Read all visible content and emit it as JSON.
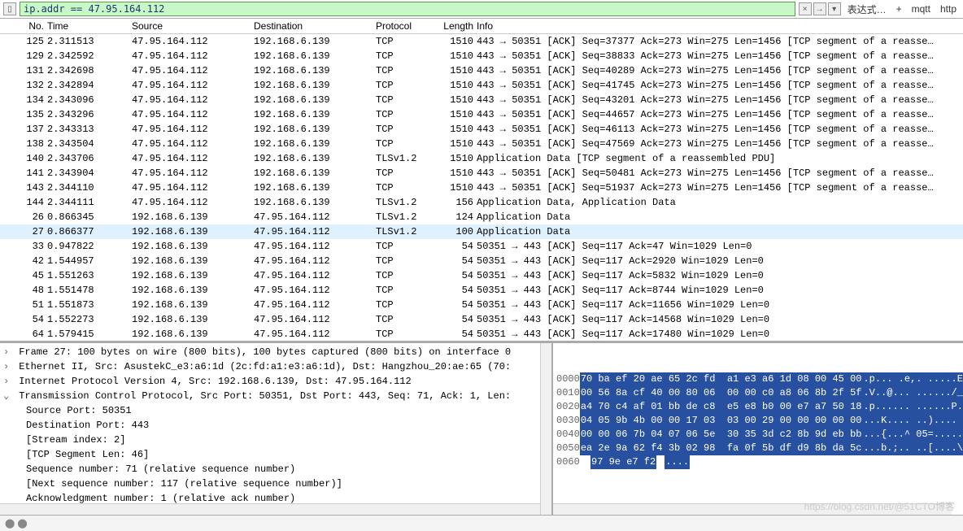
{
  "filter": {
    "value": "ip.addr == 47.95.164.112",
    "clear_icon": "×",
    "dropdown_icon": "▾",
    "expression_label": "表达式…",
    "plus": "+",
    "link_mqtt": "mqtt",
    "link_http": "http"
  },
  "columns": {
    "no": "No.",
    "time": "Time",
    "source": "Source",
    "destination": "Destination",
    "protocol": "Protocol",
    "length": "Length",
    "info": "Info"
  },
  "packets": [
    {
      "no": "125",
      "time": "2.311513",
      "src": "47.95.164.112",
      "dst": "192.168.6.139",
      "proto": "TCP",
      "len": "1510",
      "info": "443 → 50351 [ACK] Seq=37377 Ack=273 Win=275 Len=1456 [TCP segment of a reasse…"
    },
    {
      "no": "129",
      "time": "2.342592",
      "src": "47.95.164.112",
      "dst": "192.168.6.139",
      "proto": "TCP",
      "len": "1510",
      "info": "443 → 50351 [ACK] Seq=38833 Ack=273 Win=275 Len=1456 [TCP segment of a reasse…"
    },
    {
      "no": "131",
      "time": "2.342698",
      "src": "47.95.164.112",
      "dst": "192.168.6.139",
      "proto": "TCP",
      "len": "1510",
      "info": "443 → 50351 [ACK] Seq=40289 Ack=273 Win=275 Len=1456 [TCP segment of a reasse…"
    },
    {
      "no": "132",
      "time": "2.342894",
      "src": "47.95.164.112",
      "dst": "192.168.6.139",
      "proto": "TCP",
      "len": "1510",
      "info": "443 → 50351 [ACK] Seq=41745 Ack=273 Win=275 Len=1456 [TCP segment of a reasse…"
    },
    {
      "no": "134",
      "time": "2.343096",
      "src": "47.95.164.112",
      "dst": "192.168.6.139",
      "proto": "TCP",
      "len": "1510",
      "info": "443 → 50351 [ACK] Seq=43201 Ack=273 Win=275 Len=1456 [TCP segment of a reasse…"
    },
    {
      "no": "135",
      "time": "2.343296",
      "src": "47.95.164.112",
      "dst": "192.168.6.139",
      "proto": "TCP",
      "len": "1510",
      "info": "443 → 50351 [ACK] Seq=44657 Ack=273 Win=275 Len=1456 [TCP segment of a reasse…"
    },
    {
      "no": "137",
      "time": "2.343313",
      "src": "47.95.164.112",
      "dst": "192.168.6.139",
      "proto": "TCP",
      "len": "1510",
      "info": "443 → 50351 [ACK] Seq=46113 Ack=273 Win=275 Len=1456 [TCP segment of a reasse…"
    },
    {
      "no": "138",
      "time": "2.343504",
      "src": "47.95.164.112",
      "dst": "192.168.6.139",
      "proto": "TCP",
      "len": "1510",
      "info": "443 → 50351 [ACK] Seq=47569 Ack=273 Win=275 Len=1456 [TCP segment of a reasse…"
    },
    {
      "no": "140",
      "time": "2.343706",
      "src": "47.95.164.112",
      "dst": "192.168.6.139",
      "proto": "TLSv1.2",
      "len": "1510",
      "info": "Application Data [TCP segment of a reassembled PDU]"
    },
    {
      "no": "141",
      "time": "2.343904",
      "src": "47.95.164.112",
      "dst": "192.168.6.139",
      "proto": "TCP",
      "len": "1510",
      "info": "443 → 50351 [ACK] Seq=50481 Ack=273 Win=275 Len=1456 [TCP segment of a reasse…"
    },
    {
      "no": "143",
      "time": "2.344110",
      "src": "47.95.164.112",
      "dst": "192.168.6.139",
      "proto": "TCP",
      "len": "1510",
      "info": "443 → 50351 [ACK] Seq=51937 Ack=273 Win=275 Len=1456 [TCP segment of a reasse…"
    },
    {
      "no": "144",
      "time": "2.344111",
      "src": "47.95.164.112",
      "dst": "192.168.6.139",
      "proto": "TLSv1.2",
      "len": "156",
      "info": "Application Data, Application Data"
    },
    {
      "no": "26",
      "time": "0.866345",
      "src": "192.168.6.139",
      "dst": "47.95.164.112",
      "proto": "TLSv1.2",
      "len": "124",
      "info": "Application Data"
    },
    {
      "no": "27",
      "time": "0.866377",
      "src": "192.168.6.139",
      "dst": "47.95.164.112",
      "proto": "TLSv1.2",
      "len": "100",
      "info": "Application Data"
    },
    {
      "no": "33",
      "time": "0.947822",
      "src": "192.168.6.139",
      "dst": "47.95.164.112",
      "proto": "TCP",
      "len": "54",
      "info": "50351 → 443 [ACK] Seq=117 Ack=47 Win=1029 Len=0"
    },
    {
      "no": "42",
      "time": "1.544957",
      "src": "192.168.6.139",
      "dst": "47.95.164.112",
      "proto": "TCP",
      "len": "54",
      "info": "50351 → 443 [ACK] Seq=117 Ack=2920 Win=1029 Len=0"
    },
    {
      "no": "45",
      "time": "1.551263",
      "src": "192.168.6.139",
      "dst": "47.95.164.112",
      "proto": "TCP",
      "len": "54",
      "info": "50351 → 443 [ACK] Seq=117 Ack=5832 Win=1029 Len=0"
    },
    {
      "no": "48",
      "time": "1.551478",
      "src": "192.168.6.139",
      "dst": "47.95.164.112",
      "proto": "TCP",
      "len": "54",
      "info": "50351 → 443 [ACK] Seq=117 Ack=8744 Win=1029 Len=0"
    },
    {
      "no": "51",
      "time": "1.551873",
      "src": "192.168.6.139",
      "dst": "47.95.164.112",
      "proto": "TCP",
      "len": "54",
      "info": "50351 → 443 [ACK] Seq=117 Ack=11656 Win=1029 Len=0"
    },
    {
      "no": "54",
      "time": "1.552273",
      "src": "192.168.6.139",
      "dst": "47.95.164.112",
      "proto": "TCP",
      "len": "54",
      "info": "50351 → 443 [ACK] Seq=117 Ack=14568 Win=1029 Len=0"
    },
    {
      "no": "64",
      "time": "1.579415",
      "src": "192.168.6.139",
      "dst": "47.95.164.112",
      "proto": "TCP",
      "len": "54",
      "info": "50351 → 443 [ACK] Seq=117 Ack=17480 Win=1029 Len=0"
    }
  ],
  "selected_index": 13,
  "details": {
    "frame": "Frame 27: 100 bytes on wire (800 bits), 100 bytes captured (800 bits) on interface 0",
    "eth": "Ethernet II, Src: AsustekC_e3:a6:1d (2c:fd:a1:e3:a6:1d), Dst: Hangzhou_20:ae:65 (70:",
    "ip": "Internet Protocol Version 4, Src: 192.168.6.139, Dst: 47.95.164.112",
    "tcp": "Transmission Control Protocol, Src Port: 50351, Dst Port: 443, Seq: 71, Ack: 1, Len:",
    "tcp_children": [
      "Source Port: 50351",
      "Destination Port: 443",
      "[Stream index: 2]",
      "[TCP Segment Len: 46]",
      "Sequence number: 71    (relative sequence number)",
      "[Next sequence number: 117    (relative sequence number)]",
      "Acknowledgment number: 1    (relative ack number)"
    ]
  },
  "hex": {
    "rows": [
      {
        "off": "0000",
        "b1": "70 ba ef 20 ae 65 2c fd",
        "b2": "a1 e3 a6 1d 08 00 45 00",
        "a": ".p... .e,. .....E."
      },
      {
        "off": "0010",
        "b1": "00 56 8a cf 40 00 80 06",
        "b2": "00 00 c0 a8 06 8b 2f 5f",
        "a": ".V..@... ....../_"
      },
      {
        "off": "0020",
        "b1": "a4 70 c4 af 01 bb de c8",
        "b2": "e5 e8 b0 00 e7 a7 50 18",
        "a": ".p...... ......P."
      },
      {
        "off": "0030",
        "b1": "04 05 9b 4b 00 00 17 03",
        "b2": "03 00 29 00 00 00 00 00",
        "a": "...K.... ..).... "
      },
      {
        "off": "0040",
        "b1": "00 00 06 7b 04 07 06 5e",
        "b2": "30 35 3d c2 8b 9d eb bb",
        "a": "...{...^ 05=....."
      },
      {
        "off": "0050",
        "b1": "ea 2e 9a 62 f4 3b 02 98",
        "b2": "fa 0f 5b df d9 8b da 5c",
        "a": "...b.;.. ..[....\\"
      },
      {
        "off": "0060",
        "b1": "97 9e e7 f2",
        "b2": "",
        "a": "...."
      }
    ]
  },
  "watermark": "https://blog.csdn.net/@51CTO博客"
}
